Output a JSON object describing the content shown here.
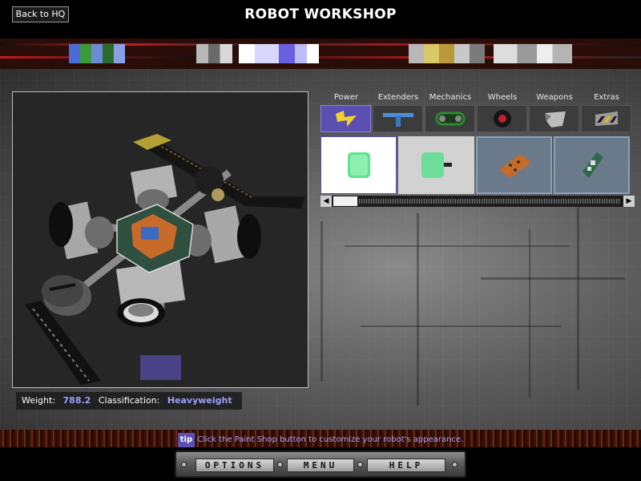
{
  "header": {
    "back_label": "Back to HQ",
    "title": "ROBOT WORKSHOP"
  },
  "stats": {
    "weight_label": "Weight:",
    "weight_value": "788.2",
    "class_label": "Classification:",
    "class_value": "Heavyweight"
  },
  "categories": [
    {
      "label": "Power",
      "icon": "lightning-icon",
      "active": true
    },
    {
      "label": "Extenders",
      "icon": "extender-bar-icon",
      "active": false
    },
    {
      "label": "Mechanics",
      "icon": "chain-drive-icon",
      "active": false
    },
    {
      "label": "Wheels",
      "icon": "wheel-icon",
      "active": false
    },
    {
      "label": "Weapons",
      "icon": "weapon-blade-icon",
      "active": false
    },
    {
      "label": "Extras",
      "icon": "extras-plate-icon",
      "active": false
    }
  ],
  "parts": [
    {
      "icon": "green-battery-icon",
      "selected": true
    },
    {
      "icon": "green-battery-connector-icon",
      "selected": false
    },
    {
      "icon": "orange-circuit-board-icon",
      "selected": false
    },
    {
      "icon": "green-circuit-board-icon",
      "selected": false
    }
  ],
  "tip": {
    "badge": "tip",
    "text": "Click the Paint Shop button to customize your robot's appearance."
  },
  "menu": {
    "options": "OPTIONS",
    "menu": "MENU",
    "help": "HELP"
  },
  "colors": {
    "accent_purple": "#5b4fb2",
    "stat_value_blue": "#9aa0ff",
    "tip_text": "#a7a4ff"
  }
}
